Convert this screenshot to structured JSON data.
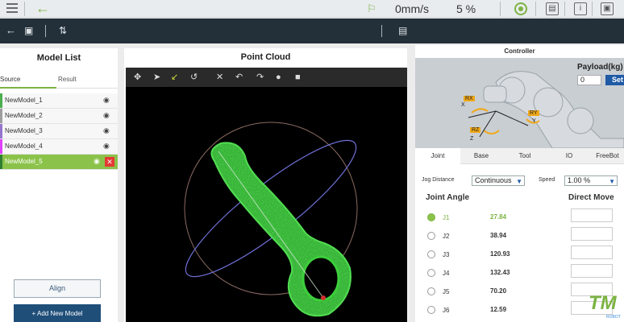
{
  "topbar": {
    "speed": "0mm/s",
    "speed_percent": "5 %",
    "icons": [
      "menu-icon",
      "back-arrow-icon",
      "robot-status-icon",
      "status-indicator-icon",
      "display-icon",
      "info-icon",
      "window-icon"
    ]
  },
  "toolbar": {
    "icons": [
      "back-icon",
      "save-icon",
      "settings-sliders-icon",
      "book-icon"
    ]
  },
  "model_list": {
    "title": "Model List",
    "tabs": [
      "Source",
      "Result"
    ],
    "models": [
      {
        "name": "NewModel_1",
        "color": "#4caf50"
      },
      {
        "name": "NewModel_2",
        "color": "#9e9e9e"
      },
      {
        "name": "NewModel_3",
        "color": "#9575cd"
      },
      {
        "name": "NewModel_4",
        "color": "#e040fb"
      },
      {
        "name": "NewModel_5",
        "color": "#8bc34a",
        "selected": true
      }
    ],
    "align_label": "Align",
    "add_label": "+ Add New Model"
  },
  "point_cloud": {
    "title": "Point Cloud"
  },
  "controller": {
    "title": "Controller",
    "payload_label": "Payload(kg)",
    "payload_value": "0",
    "set_label": "Set",
    "axis_labels": [
      "RX",
      "X",
      "RZ",
      "Z",
      "RY",
      "Y"
    ],
    "tabs": [
      "Joint",
      "Base",
      "Tool",
      "IO",
      "FreeBot"
    ],
    "jog_distance_label": "Jog Distance",
    "jog_distance_value": "Continuous",
    "speed_label": "Speed",
    "speed_value": "1.00 %",
    "joint_angle_title": "Joint Angle",
    "direct_move_title": "Direct Move",
    "joints": [
      {
        "name": "J1",
        "value": "27.84",
        "active": true
      },
      {
        "name": "J2",
        "value": "38.94"
      },
      {
        "name": "J3",
        "value": "120.93"
      },
      {
        "name": "J4",
        "value": "132.43"
      },
      {
        "name": "J5",
        "value": "70.20"
      },
      {
        "name": "J6",
        "value": "12.59"
      }
    ]
  },
  "logo": {
    "main": "TM",
    "sub": "ROBOT"
  }
}
